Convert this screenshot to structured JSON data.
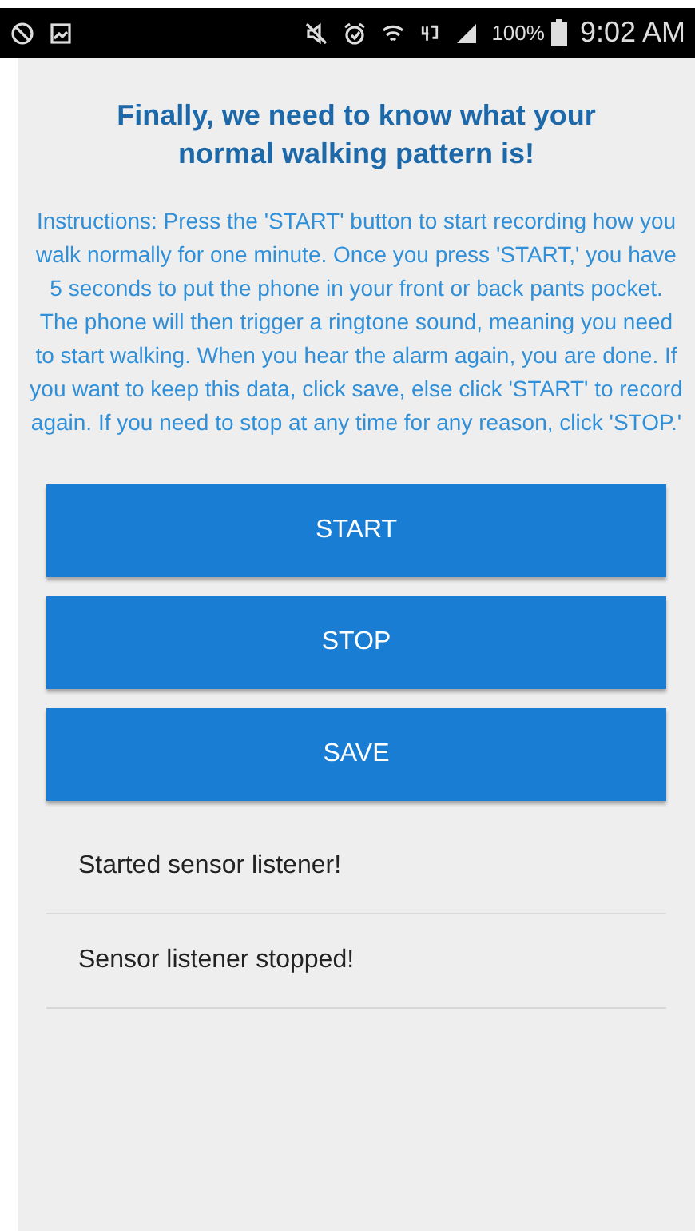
{
  "status_bar": {
    "battery": "100%",
    "time": "9:02 AM"
  },
  "title": "Finally, we need to know what your normal walking pattern is!",
  "instructions": "Instructions: Press the 'START' button to start recording how you walk normally for one minute. Once you press 'START,' you have 5 seconds to put the phone in your front or back pants pocket. The phone will then trigger a ringtone sound, meaning you need to start walking. When you hear the alarm again, you are done. If you want to keep this data, click save, else click 'START' to record again. If you need to stop at any time for any reason, click 'STOP.'",
  "buttons": [
    "START",
    "STOP",
    "SAVE"
  ],
  "log": [
    "Started sensor listener!",
    "Sensor listener stopped!"
  ]
}
